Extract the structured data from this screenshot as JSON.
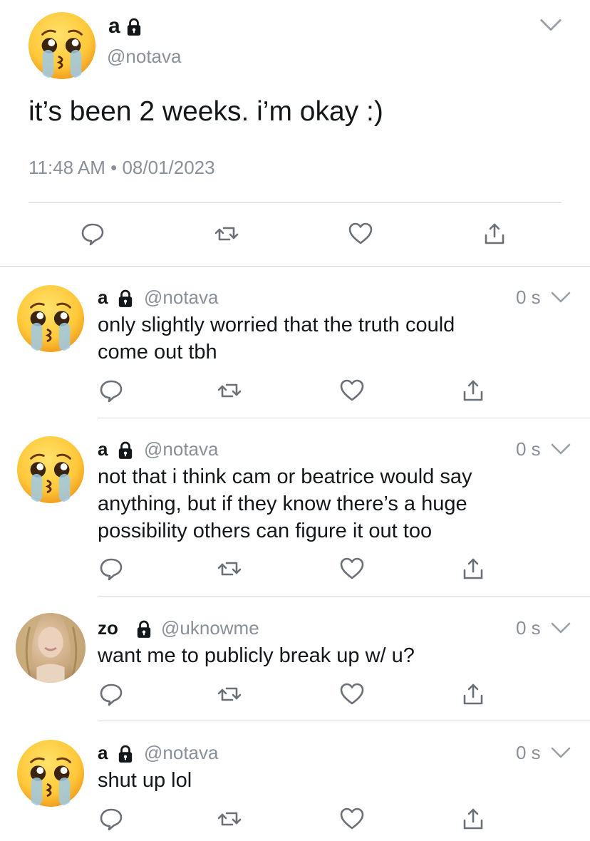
{
  "main_tweet": {
    "name": "a",
    "handle": "@notava",
    "text": "it’s been 2 weeks. i’m okay :)",
    "timestamp": "11:48 AM • 08/01/2023"
  },
  "replies": [
    {
      "name": "a",
      "handle": "@notava",
      "time": "0 s",
      "text_lines": [
        "only slightly worried that the truth could",
        "come out tbh"
      ]
    },
    {
      "name": "a",
      "handle": "@notava",
      "time": "0 s",
      "text_lines": [
        "not that i think cam or beatrice would say",
        "anything, but if they know there’s a huge",
        "possibility others can figure it out too"
      ]
    },
    {
      "name": "zo",
      "handle": "@uknowme",
      "time": "0 s",
      "text_lines": [
        "want me to publicly break up w/ u?"
      ]
    },
    {
      "name": "a",
      "handle": "@notava",
      "time": "0 s",
      "text_lines": [
        "shut up lol"
      ]
    }
  ],
  "icons": {
    "reply": "speech-bubble-icon",
    "retweet": "retweet-icon",
    "like": "heart-icon",
    "share": "share-icon",
    "more": "chevron-down-icon",
    "lock": "lock-icon",
    "avatar_emoji": "crying-face-emoji"
  },
  "colors": {
    "text": "#14171a",
    "muted": "#8a8f98",
    "divider": "#d7dadd"
  }
}
